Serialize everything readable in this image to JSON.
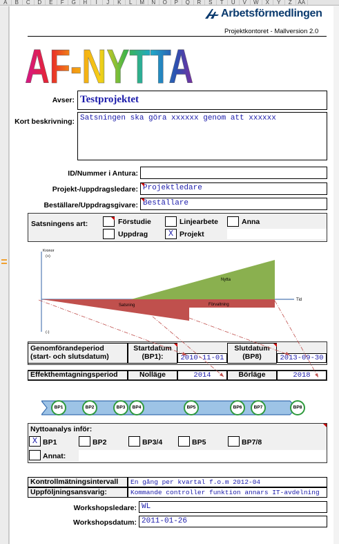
{
  "column_headers": [
    "A",
    "B",
    "C",
    "D",
    "E",
    "F",
    "G",
    "H",
    "I",
    "J",
    "K",
    "L",
    "M",
    "N",
    "O",
    "P",
    "Q",
    "R",
    "S",
    "T",
    "U",
    "V",
    "W",
    "X",
    "Y",
    "Z",
    "AA"
  ],
  "header": {
    "org_name": "Arbetsförmedlingen",
    "subtitle": "Projektkontoret - Mallversion 2.0",
    "logo_text": "AF-NYTTA"
  },
  "form": {
    "avser_label": "Avser:",
    "avser_value": "Testprojektet",
    "kort_label": "Kort beskrivning:",
    "kort_value": "Satsningen ska göra xxxxxx genom att xxxxxx",
    "id_label": "ID/Nummer i Antura:",
    "id_value": "",
    "ledare_label": "Projekt-/uppdragsledare:",
    "ledare_value": "Projektledare",
    "bestallare_label": "Beställare/Uppdragsgivare:",
    "bestallare_value": "Beställare"
  },
  "satsning": {
    "label": "Satsningens art:",
    "options": [
      {
        "label": "Förstudie",
        "mark": ""
      },
      {
        "label": "Linjearbete",
        "mark": ""
      },
      {
        "label": "Anna",
        "mark": ""
      },
      {
        "label": "Uppdrag",
        "mark": ""
      },
      {
        "label": "Projekt",
        "mark": "X"
      }
    ]
  },
  "diagram": {
    "y_label": "Kronor",
    "plus_label": "(+)",
    "minus_label": "(-)",
    "tid_label": "Tid",
    "nytta_label": "Nytta",
    "satsning_label": "Satsning",
    "forvaltning_label": "Förvaltning",
    "colors": {
      "nytta": "#8ab04f",
      "satsning": "#c0504d",
      "axis": "#6c8ebf"
    }
  },
  "period": {
    "genomforande_label_1": "Genomförandeperiod",
    "genomforande_label_2": "(start- och slutsdatum)",
    "start_label_1": "Startdatum",
    "start_label_2": "(BP1):",
    "start_value": "2010-11-01",
    "slut_label_1": "Slutdatum",
    "slut_label_2": "(BP8)",
    "slut_value": "2013-09-30",
    "effekt_label": "Effekthemtagningsperiod",
    "nollage_label": "Nolläge",
    "nollage_value": "2014",
    "borlage_label": "Börläge",
    "borlage_value": "2018"
  },
  "timeline": {
    "points": [
      "BP1",
      "BP2",
      "BP3",
      "BP4",
      "BP5",
      "BP6",
      "BP7",
      "BP8"
    ],
    "colors": {
      "band": "#9dc3e6",
      "circle": "#2e9a3c"
    }
  },
  "nyttoanalys": {
    "label": "Nyttoanalys inför:",
    "options": [
      {
        "label": "BP1",
        "mark": "X"
      },
      {
        "label": "BP2",
        "mark": ""
      },
      {
        "label": "BP3/4",
        "mark": ""
      },
      {
        "label": "BP5",
        "mark": ""
      },
      {
        "label": "BP7/8",
        "mark": ""
      }
    ],
    "annat_label": "Annat:",
    "annat_value": ""
  },
  "kontroll": {
    "interval_label": "Kontrollmätningsintervall",
    "interval_value": "En gång per kvartal f.o.m 2012-04",
    "ansvarig_label": "Uppföljningsansvarig:",
    "ansvarig_value": "Kommande controller funktion annars IT-avdelning"
  },
  "workshop": {
    "ledare_label": "Workshopsledare:",
    "ledare_value": "WL",
    "datum_label": "Workshopsdatum:",
    "datum_value": "2011-01-26"
  }
}
